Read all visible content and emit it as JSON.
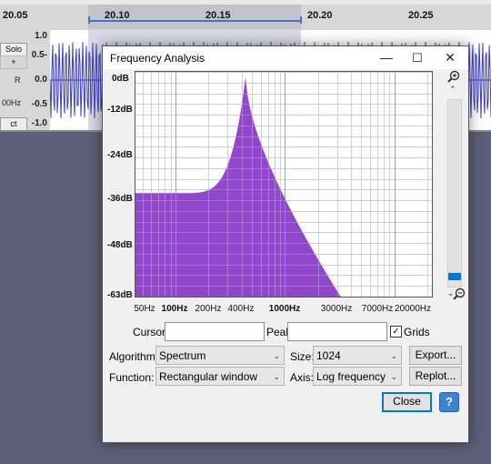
{
  "background": {
    "ruler_labels": [
      "20.05",
      "20.10",
      "20.15",
      "20.20",
      "20.25"
    ],
    "track": {
      "solo_label": "Solo",
      "plus_label": "+",
      "r_label": "R",
      "hz_label": "00Hz",
      "ct_label": "ct"
    },
    "amplitude_labels": [
      "1.0",
      "0.5-",
      "0.0",
      "-0.5",
      "-1.0"
    ]
  },
  "dialog": {
    "title": "Frequency Analysis",
    "window_buttons": {
      "minimize": "—",
      "maximize": "☐",
      "close": "✕"
    },
    "y_axis_labels": [
      "0dB",
      "-12dB",
      "-24dB",
      "-36dB",
      "-48dB",
      "-63dB"
    ],
    "x_axis_labels": [
      {
        "text": "50Hz",
        "bold": false
      },
      {
        "text": "100Hz",
        "bold": true
      },
      {
        "text": "200Hz",
        "bold": false
      },
      {
        "text": "400Hz",
        "bold": false
      },
      {
        "text": "1000Hz",
        "bold": true
      },
      {
        "text": "3000Hz",
        "bold": false
      },
      {
        "text": "7000Hz",
        "bold": false
      },
      {
        "text": "20000Hz",
        "bold": false
      }
    ],
    "zoom_in_icon": "zoom-in-icon",
    "zoom_out_icon": "zoom-out-icon",
    "cursor_label": "Cursor:",
    "cursor_value": "",
    "peak_label": "Peak:",
    "peak_value": "",
    "grids_label": "Grids",
    "grids_checked": true,
    "algorithm_label": "Algorithm:",
    "algorithm_value": "Spectrum",
    "size_label": "Size:",
    "size_value": "1024",
    "export_label": "Export...",
    "function_label": "Function:",
    "function_value": "Rectangular window",
    "axis_label": "Axis:",
    "axis_value": "Log frequency",
    "replot_label": "Replot...",
    "close_label": "Close",
    "help_label": "?",
    "colors": {
      "spectrum_fill": "#8b3dc9",
      "plot_bg": "#ffffff",
      "accent": "#0078d7"
    }
  }
}
